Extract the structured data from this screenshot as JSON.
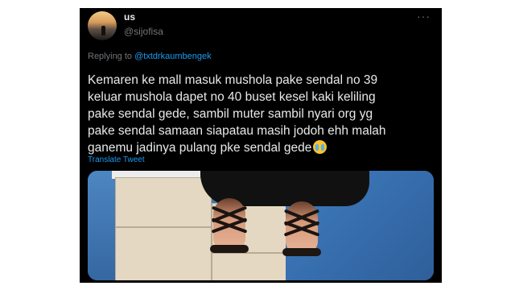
{
  "tweet": {
    "display_name": "us",
    "handle": "@sijofisa",
    "more_label": "···",
    "reply_prefix": "Replying to ",
    "reply_mention": "@txtdrkaumbengek",
    "text": "Kemaren ke mall masuk mushola pake sendal no 39\nkeluar mushola dapet no 40 buset kesel kaki keliling\npake sendal gede, sambil muter sambil nyari org yg\npake sendal samaan siapatau masih jodoh ehh malah\nganemu jadinya pulang pke sendal gede",
    "emoji_icon": "crying-face-icon",
    "translate_label": "Translate Tweet"
  },
  "colors": {
    "background": "#000000",
    "text": "#e7e9ea",
    "secondary": "#71767b",
    "accent": "#1d9bf0"
  }
}
